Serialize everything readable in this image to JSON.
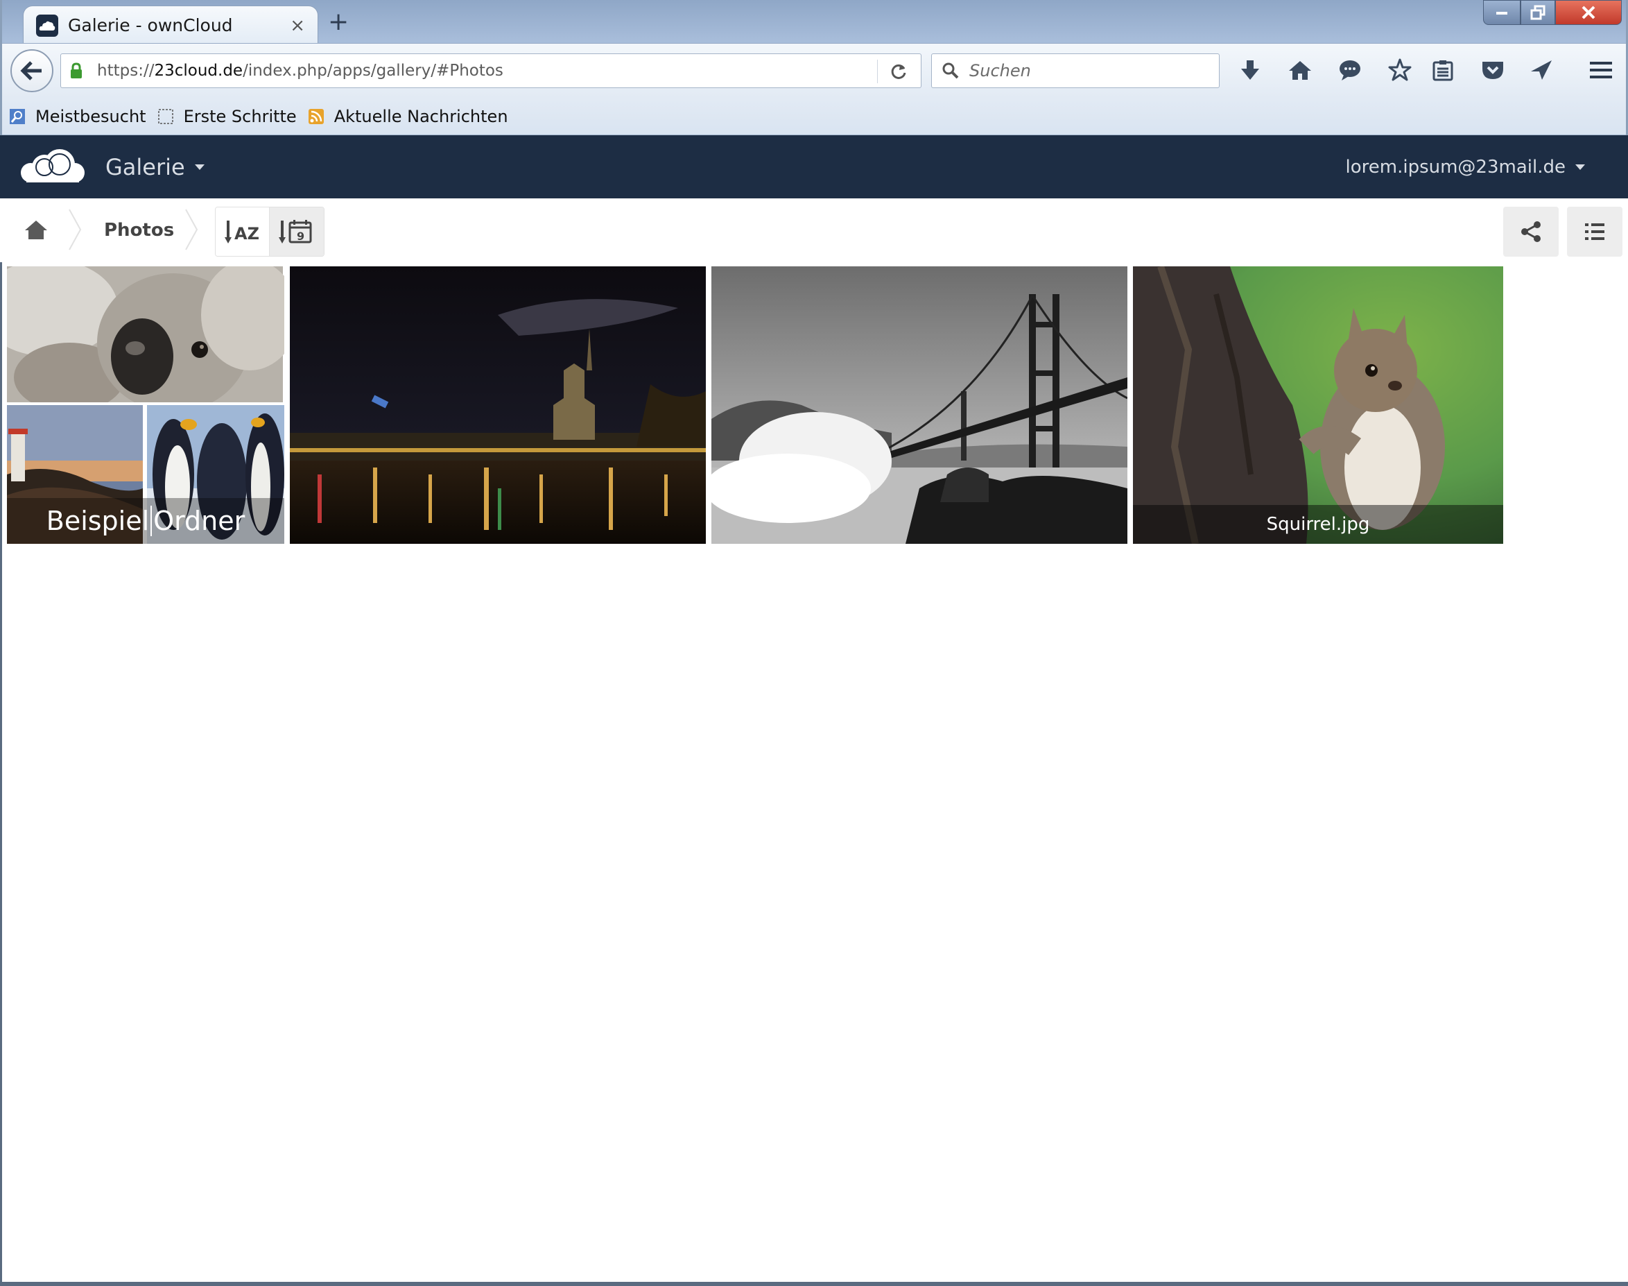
{
  "browser": {
    "tab_title": "Galerie - ownCloud",
    "new_tab_label": "+",
    "close_tab_label": "×",
    "url_prefix": "https://",
    "url_host": "23cloud.de",
    "url_path": "/index.php/apps/gallery/#Photos",
    "search_placeholder": "Suchen",
    "bookmarks": [
      {
        "label": "Meistbesucht",
        "icon": "most-visited-icon"
      },
      {
        "label": "Erste Schritte",
        "icon": "dotted-page-icon"
      },
      {
        "label": "Aktuelle Nachrichten",
        "icon": "rss-icon"
      }
    ],
    "toolbar_icons": [
      "download-icon",
      "home-icon",
      "chat-icon",
      "star-icon",
      "reading-list-icon",
      "pocket-icon",
      "send-icon",
      "menu-icon"
    ]
  },
  "app": {
    "name": "Galerie",
    "user": "lorem.ipsum@23mail.de",
    "brand_color": "#1d2d44"
  },
  "controls": {
    "breadcrumb_current": "Photos",
    "sort_name_label": "AZ",
    "sort_date_label": "9"
  },
  "gallery": {
    "album_label": "BeispielOrdner",
    "album_label_first": "Beispiel",
    "album_label_second": "Ordner",
    "file_label": "Squirrel.jpg"
  }
}
